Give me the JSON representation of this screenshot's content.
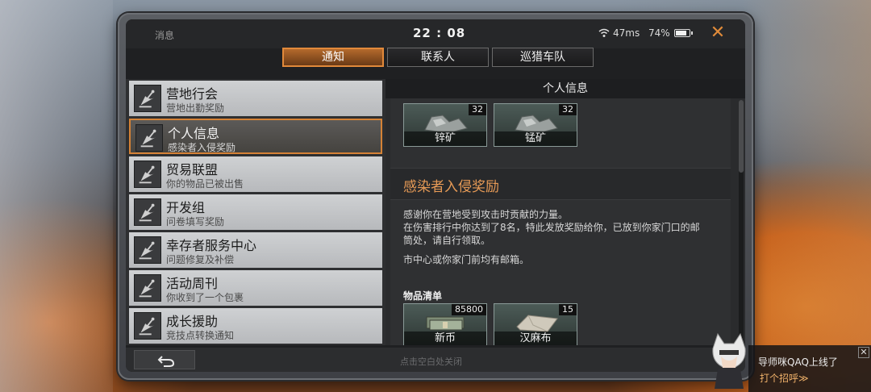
{
  "status": {
    "app_name": "消息",
    "time": "22 : 08",
    "ping": "47ms",
    "battery": "74%",
    "battery_level": 0.74
  },
  "tabs": [
    {
      "label": "通知",
      "active": true
    },
    {
      "label": "联系人",
      "active": false
    },
    {
      "label": "巡猎车队",
      "active": false
    }
  ],
  "messages": [
    {
      "title": "营地行会",
      "subtitle": "营地出勤奖励",
      "selected": false
    },
    {
      "title": "个人信息",
      "subtitle": "感染者入侵奖励",
      "selected": true
    },
    {
      "title": "贸易联盟",
      "subtitle": "你的物品已被出售",
      "selected": false
    },
    {
      "title": "开发组",
      "subtitle": "问卷填写奖励",
      "selected": false
    },
    {
      "title": "幸存者服务中心",
      "subtitle": "问题修复及补偿",
      "selected": false
    },
    {
      "title": "活动周刊",
      "subtitle": "你收到了一个包裹",
      "selected": false
    },
    {
      "title": "成长援助",
      "subtitle": "竞技点转换通知",
      "selected": false
    }
  ],
  "detail": {
    "header": "个人信息",
    "top_items": [
      {
        "name": "锌矿",
        "count": "32",
        "icon": "ore-icon"
      },
      {
        "name": "锰矿",
        "count": "32",
        "icon": "ore-icon"
      }
    ],
    "section_title": "感染者入侵奖励",
    "paragraph1_line1": "感谢你在营地受到攻击时贡献的力量。",
    "paragraph1_line2": "在伤害排行中你达到了8名，特此发放奖励给你，已放到你家门口的邮",
    "paragraph1_line3": "筒处，请自行领取。",
    "paragraph2": "市中心或你家门前均有邮箱。",
    "items_label": "物品清单",
    "reward_items": [
      {
        "name": "新币",
        "count": "85800",
        "icon": "cash-icon"
      },
      {
        "name": "汉麻布",
        "count": "15",
        "icon": "cloth-icon"
      }
    ]
  },
  "bottom": {
    "hint": "点击空白处关闭"
  },
  "guide": {
    "message": "导师咪QAQ上线了",
    "action": "打个招呼≫"
  },
  "colors": {
    "accent": "#e1893a",
    "selected_border": "#d58236",
    "section_title": "#e69a56"
  }
}
